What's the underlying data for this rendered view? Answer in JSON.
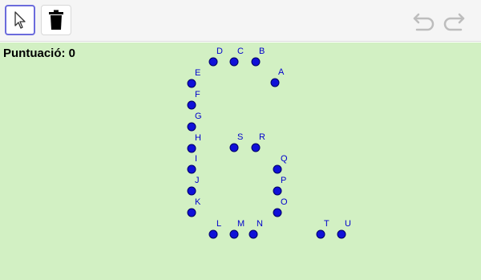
{
  "toolbar": {
    "tools": [
      {
        "name": "move-tool",
        "icon": "cursor-arrow-icon",
        "selected": true
      },
      {
        "name": "delete-tool",
        "icon": "trash-icon",
        "selected": false
      }
    ],
    "undo_icon": "undo-icon",
    "redo_icon": "redo-icon"
  },
  "score": {
    "label": "Puntuació: 0"
  },
  "points": [
    {
      "id": "D",
      "label": "D"
    },
    {
      "id": "C",
      "label": "C"
    },
    {
      "id": "B",
      "label": "B"
    },
    {
      "id": "A",
      "label": "A"
    },
    {
      "id": "E",
      "label": "E"
    },
    {
      "id": "F",
      "label": "F"
    },
    {
      "id": "G",
      "label": "G"
    },
    {
      "id": "H",
      "label": "H"
    },
    {
      "id": "S",
      "label": "S"
    },
    {
      "id": "R",
      "label": "R"
    },
    {
      "id": "I",
      "label": "I"
    },
    {
      "id": "Q",
      "label": "Q"
    },
    {
      "id": "J",
      "label": "J"
    },
    {
      "id": "P",
      "label": "P"
    },
    {
      "id": "K",
      "label": "K"
    },
    {
      "id": "O",
      "label": "O"
    },
    {
      "id": "L",
      "label": "L"
    },
    {
      "id": "M",
      "label": "M"
    },
    {
      "id": "N",
      "label": "N"
    },
    {
      "id": "T",
      "label": "T"
    },
    {
      "id": "U",
      "label": "U"
    }
  ],
  "colors": {
    "canvas_bg": "#d2f0c3",
    "point_fill": "#1010d8",
    "point_stroke": "#000066",
    "label_color": "#0000cc",
    "selected_border": "#6b6bdc"
  }
}
